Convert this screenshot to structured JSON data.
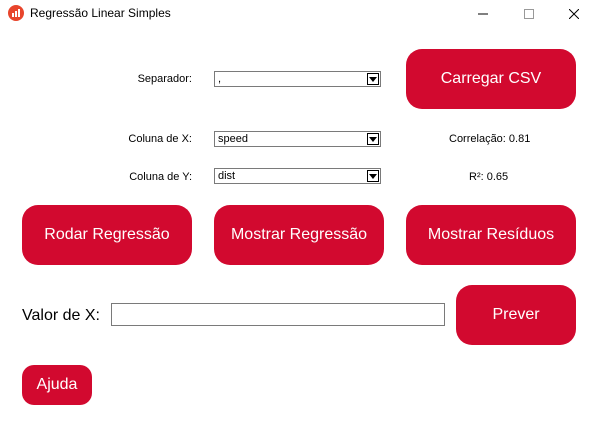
{
  "window": {
    "title": "Regressão Linear Simples",
    "icon": "bar-chart-app-icon",
    "controls": [
      "minimize-icon",
      "maximize-icon",
      "close-icon"
    ]
  },
  "form": {
    "separator_label": "Separador:",
    "separator_value": ",",
    "x_label": "Coluna de X:",
    "x_value": "speed",
    "y_label": "Coluna de Y:",
    "y_value": "dist"
  },
  "stats": {
    "correlation": "Correlação: 0.81",
    "r2": "R²: 0.65"
  },
  "buttons": {
    "load_csv": "Carregar CSV",
    "run_regression": "Rodar Regressão",
    "show_regression": "Mostrar Regressão",
    "show_residuals": "Mostrar Resíduos",
    "predict": "Prever",
    "help": "Ajuda"
  },
  "predict": {
    "x_value_label": "Valor de X:",
    "x_value": ""
  },
  "colors": {
    "accent": "#d2092f"
  }
}
